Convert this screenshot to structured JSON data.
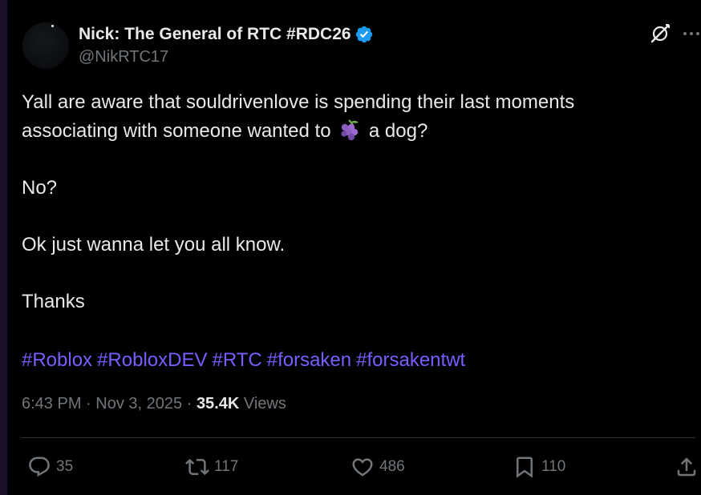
{
  "author": {
    "display_name": "Nick: The General of RTC #RDC26",
    "handle": "@NikRTC17",
    "verified_color": "#1d9bf0"
  },
  "post": {
    "line1": "Yall are aware that souldrivenlove is spending their last moments",
    "line2_before": "associating with someone wanted to",
    "line2_emoji": "grapes-emoji",
    "line2_after": "a dog?",
    "para2": "No?",
    "para3": "Ok just wanna let you all know.",
    "para4": "Thanks",
    "hashtags": [
      "#Roblox",
      "#RobloxDEV",
      "#RTC",
      "#forsaken",
      "#forsakentwt"
    ],
    "hashtag_color": "#7b5cff"
  },
  "meta": {
    "time": "6:43 PM",
    "sep1": "·",
    "date": "Nov 3, 2025",
    "sep2": "·",
    "views_count": "35.4K",
    "views_label": "Views"
  },
  "actions": {
    "replies": "35",
    "reposts": "117",
    "likes": "486",
    "bookmarks": "110"
  }
}
